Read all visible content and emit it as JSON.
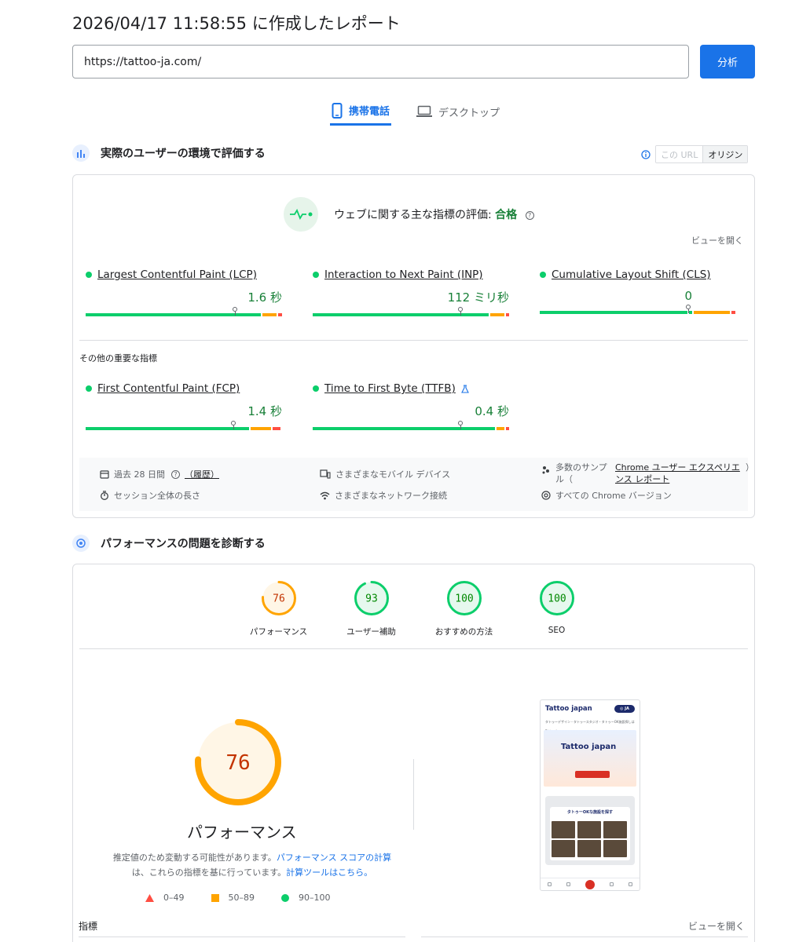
{
  "report_title": "2026/04/17 11:58:55 に作成したレポート",
  "url_input": {
    "value": "https://tattoo-ja.com/"
  },
  "analyze_label": "分析",
  "tabs": [
    {
      "label": "携帯電話",
      "active": true,
      "icon": "phone-icon"
    },
    {
      "label": "デスクトップ",
      "active": false,
      "icon": "laptop-icon"
    }
  ],
  "field": {
    "title": "実際のユーザーの環境で評価する",
    "toggle": {
      "this_url": "この URL",
      "origin": "オリジン",
      "selected": "オリジン"
    },
    "assessment_prefix": "ウェブに関する主な指標の評価:",
    "assessment_result": "合格",
    "view_link": "ビューを開く",
    "core_metrics": [
      {
        "name": "Largest Contentful Paint (LCP)",
        "value": "1.6 秒",
        "marker": 0.76
      },
      {
        "name": "Interaction to Next Paint (INP)",
        "value": "112 ミリ秒",
        "marker": 0.75
      },
      {
        "name": "Cumulative Layout Shift (CLS)",
        "value": "0",
        "marker": 0.75
      }
    ],
    "other_label": "その他の重要な指標",
    "other_metrics": [
      {
        "name": "First Contentful Paint (FCP)",
        "value": "1.4 秒",
        "marker": 0.75
      },
      {
        "name": "Time to First Byte (TTFB)",
        "value": "0.4 秒",
        "marker": 0.75,
        "experimental_icon": "flask-icon"
      }
    ],
    "footer": {
      "period": "過去 28 日間",
      "history": "（履歴）",
      "devices": "さまざまなモバイル デバイス",
      "samples_prefix": "多数のサンプル（",
      "samples_link": "Chrome ユーザー エクスペリエンス レポート",
      "samples_suffix": "）",
      "session": "セッション全体の長さ",
      "network": "さまざまなネットワーク接続",
      "chrome": "すべての Chrome バージョン"
    }
  },
  "lab": {
    "title": "パフォーマンスの問題を診断する",
    "scores": [
      {
        "label": "パフォーマンス",
        "score": 76
      },
      {
        "label": "ユーザー補助",
        "score": 93
      },
      {
        "label": "おすすめの方法",
        "score": 100
      },
      {
        "label": "SEO",
        "score": 100
      }
    ],
    "main_score": 76,
    "main_label": "パフォーマンス",
    "note_prefix": "推定値のため変動する可能性があります。",
    "note_link1": "パフォーマンス スコアの計算",
    "note_middle": "は、これらの指標を基に行っています。",
    "note_link2": "計算ツールはこちら。",
    "legend": [
      {
        "range": "0–49",
        "color": "#ff4e42",
        "shape": "triangle"
      },
      {
        "range": "50–89",
        "color": "#ffa400",
        "shape": "square"
      },
      {
        "range": "90–100",
        "color": "#0cce6b",
        "shape": "circle"
      }
    ],
    "preview": {
      "site_name": "Tattoo japan",
      "lang_badge": "◎ JA",
      "tagline": "タトゥーデザイン・タトゥースタジオ・タトゥーOK施設探しはTattoo Japan",
      "banner_logo": "Tattoo japan",
      "search_title": "タトゥーOKな施設を探す"
    },
    "metrics_label": "指標",
    "metrics_view": "ビューを開く"
  },
  "colors": {
    "accent": "#1a73e8",
    "good": "#0cce6b",
    "average": "#ffa400",
    "poor": "#ff4e42",
    "pass_text": "#188038",
    "avg_text": "#c33300"
  }
}
